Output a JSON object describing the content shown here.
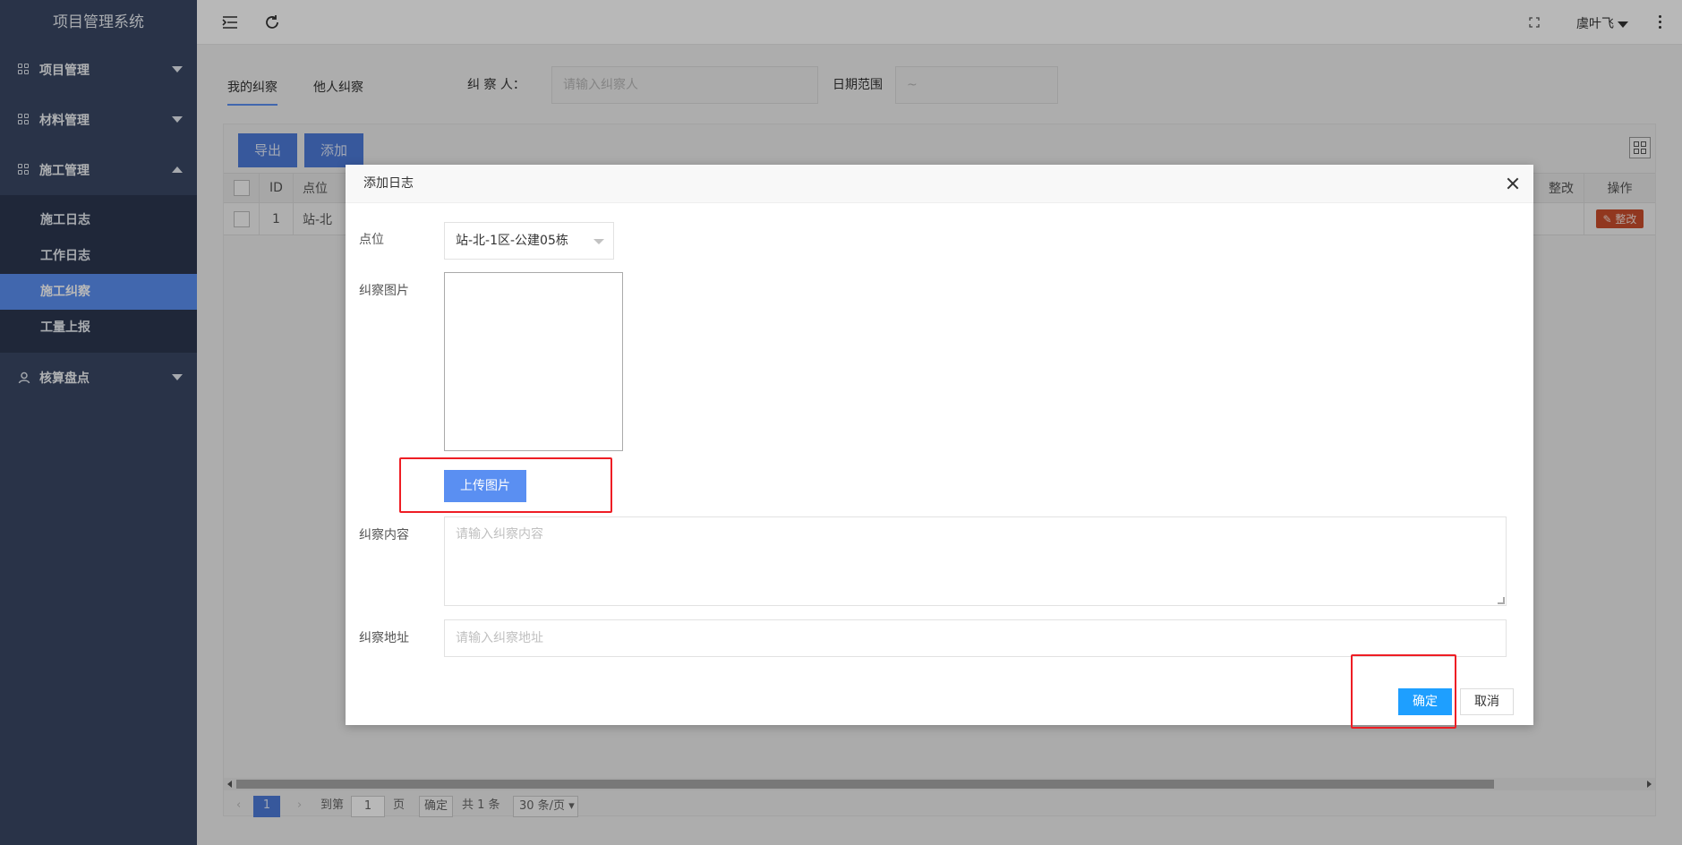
{
  "sidebar": {
    "title": "项目管理系统",
    "groups": [
      {
        "label": "项目管理"
      },
      {
        "label": "材料管理"
      },
      {
        "label": "施工管理"
      },
      {
        "label": "核算盘点"
      }
    ],
    "subitems": [
      {
        "label": "施工日志"
      },
      {
        "label": "工作日志"
      },
      {
        "label": "施工纠察"
      },
      {
        "label": "工量上报"
      }
    ]
  },
  "topbar": {
    "user": "虞叶飞"
  },
  "filter": {
    "tabs": [
      "我的纠察",
      "他人纠察"
    ],
    "inspector_label": "纠 察 人：",
    "inspector_placeholder": "请输入纠察人",
    "date_label": "日期范围",
    "date_placeholder": "~"
  },
  "toolbar": {
    "export_label": "导出",
    "add_label": "添加"
  },
  "table": {
    "headers": [
      "ID",
      "点位",
      "整改",
      "操作"
    ],
    "rows": [
      {
        "id": "1",
        "location": "站-北",
        "action": "整改"
      }
    ]
  },
  "pager": {
    "current": "1",
    "goto_label": "到第",
    "goto_value": "1",
    "page_label": "页",
    "confirm_label": "确定",
    "total_label": "共 1 条",
    "page_size": "30 条/页"
  },
  "dialog": {
    "title": "添加日志",
    "location_label": "点位",
    "location_value": "站-北-1区-公建05栋",
    "image_label": "纠察图片",
    "upload_label": "上传图片",
    "content_label": "纠察内容",
    "content_placeholder": "请输入纠察内容",
    "address_label": "纠察地址",
    "address_placeholder": "请输入纠察地址",
    "ok_label": "确定",
    "cancel_label": "取消"
  },
  "colors": {
    "sidebar_bg": "#394764",
    "sidebar_active": "#5a8ff2",
    "primary": "#1e9fff",
    "highlight": "#ee1d24"
  }
}
